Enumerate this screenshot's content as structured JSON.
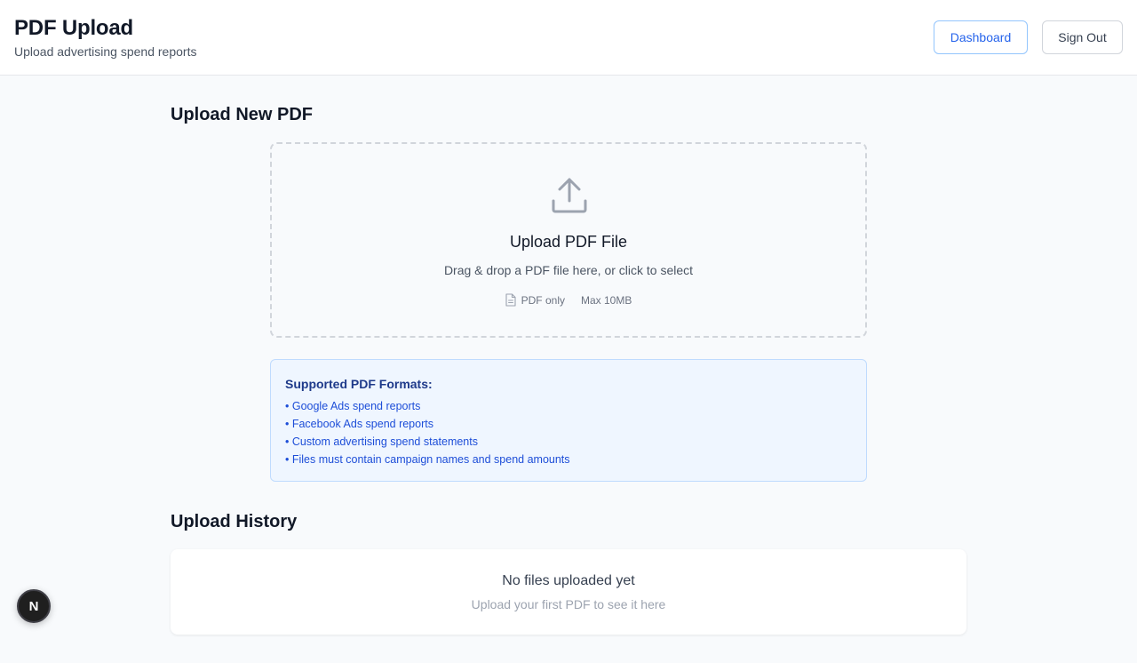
{
  "header": {
    "title": "PDF Upload",
    "subtitle": "Upload advertising spend reports",
    "dashboard_label": "Dashboard",
    "signout_label": "Sign Out"
  },
  "upload": {
    "section_title": "Upload New PDF",
    "dropzone_title": "Upload PDF File",
    "dropzone_subtitle": "Drag & drop a PDF file here, or click to select",
    "file_type_label": "PDF only",
    "max_size_label": "Max 10MB"
  },
  "formats": {
    "title": "Supported PDF Formats:",
    "items": [
      "• Google Ads spend reports",
      "• Facebook Ads spend reports",
      "• Custom advertising spend statements",
      "• Files must contain campaign names and spend amounts"
    ]
  },
  "history": {
    "section_title": "Upload History",
    "empty_title": "No files uploaded yet",
    "empty_subtitle": "Upload your first PDF to see it here"
  },
  "badge": {
    "letter": "N"
  },
  "colors": {
    "accent": "#2563eb",
    "info_bg": "#eff6ff",
    "info_text": "#1d4ed8",
    "page_bg": "#f8fafc"
  },
  "icons": [
    "upload-icon",
    "document-icon",
    "nextjs-icon"
  ]
}
